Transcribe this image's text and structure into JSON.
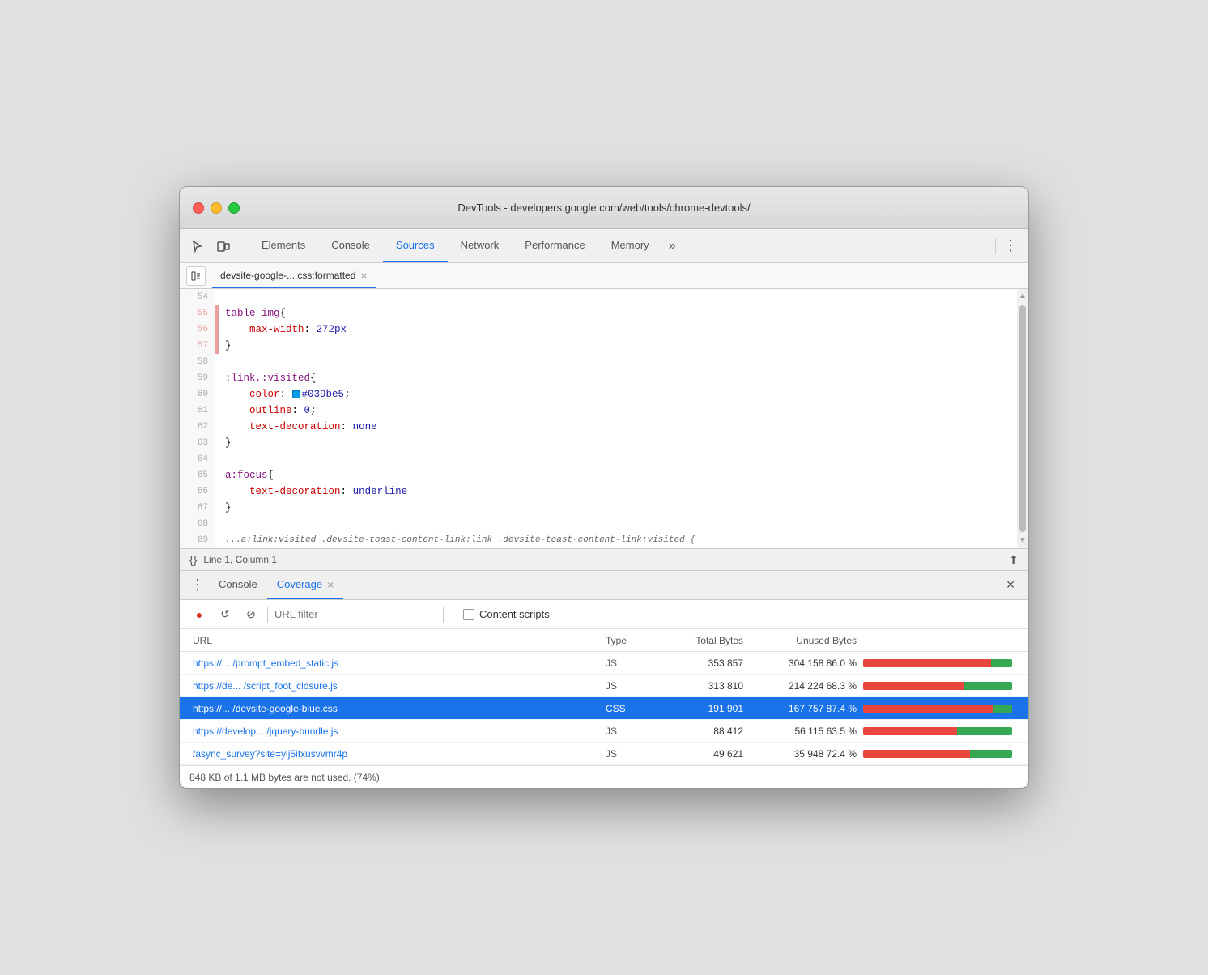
{
  "window": {
    "title": "DevTools - developers.google.com/web/tools/chrome-devtools/"
  },
  "tabs": {
    "elements": "Elements",
    "console": "Console",
    "sources": "Sources",
    "network": "Network",
    "performance": "Performance",
    "memory": "Memory",
    "more": "»"
  },
  "file_tab": {
    "name": "devsite-google-....css:formatted",
    "close": "×"
  },
  "code": {
    "lines": [
      {
        "num": "54",
        "content": ""
      },
      {
        "num": "55",
        "content": "table img {",
        "marked": true
      },
      {
        "num": "56",
        "content": "    max-width: 272px",
        "marked": true
      },
      {
        "num": "57",
        "content": "}",
        "marked": true
      },
      {
        "num": "58",
        "content": ""
      },
      {
        "num": "59",
        "content": ":link,:visited {"
      },
      {
        "num": "60",
        "content": "    color: #039be5;"
      },
      {
        "num": "61",
        "content": "    outline: 0;"
      },
      {
        "num": "62",
        "content": "    text-decoration: none"
      },
      {
        "num": "63",
        "content": "}"
      },
      {
        "num": "64",
        "content": ""
      },
      {
        "num": "65",
        "content": "a:focus {"
      },
      {
        "num": "66",
        "content": "    text-decoration: underline"
      },
      {
        "num": "67",
        "content": "}"
      },
      {
        "num": "68",
        "content": ""
      },
      {
        "num": "69",
        "content": "...a:link:visited .devsite-toast-content-link:link .devsite-toast-content-link:visited {",
        "truncated": true
      }
    ]
  },
  "status_bar": {
    "icon": "{}",
    "position": "Line 1, Column 1",
    "scroll_icon": "⬆"
  },
  "bottom_panel": {
    "tabs": {
      "console": "Console",
      "coverage": "Coverage",
      "close_icon": "×"
    }
  },
  "coverage": {
    "toolbar": {
      "record_icon": "●",
      "refresh_icon": "↺",
      "stop_icon": "⊘",
      "filter_placeholder": "URL filter",
      "content_scripts_label": "Content scripts"
    },
    "table": {
      "headers": {
        "url": "URL",
        "type": "Type",
        "total_bytes": "Total Bytes",
        "unused_bytes": "Unused Bytes",
        "bar": ""
      },
      "rows": [
        {
          "url": "https://... /prompt_embed_static.js",
          "type": "JS",
          "total_bytes": "353 857",
          "unused_bytes": "304 158",
          "unused_pct": "86.0 %",
          "bar_unused_pct": 86,
          "bar_used_pct": 14,
          "selected": false
        },
        {
          "url": "https://de... /script_foot_closure.js",
          "type": "JS",
          "total_bytes": "313 810",
          "unused_bytes": "214 224",
          "unused_pct": "68.3 %",
          "bar_unused_pct": 68,
          "bar_used_pct": 32,
          "selected": false
        },
        {
          "url": "https://... /devsite-google-blue.css",
          "type": "CSS",
          "total_bytes": "191 901",
          "unused_bytes": "167 757",
          "unused_pct": "87.4 %",
          "bar_unused_pct": 87,
          "bar_used_pct": 13,
          "selected": true
        },
        {
          "url": "https://develop... /jquery-bundle.js",
          "type": "JS",
          "total_bytes": "88 412",
          "unused_bytes": "56 115",
          "unused_pct": "63.5 %",
          "bar_unused_pct": 63,
          "bar_used_pct": 37,
          "selected": false
        },
        {
          "url": "/async_survey?site=ylj5ifxusvvmr4p",
          "type": "JS",
          "total_bytes": "49 621",
          "unused_bytes": "35 948",
          "unused_pct": "72.4 %",
          "bar_unused_pct": 72,
          "bar_used_pct": 28,
          "selected": false
        }
      ]
    },
    "footer": "848 KB of 1.1 MB bytes are not used. (74%)"
  }
}
